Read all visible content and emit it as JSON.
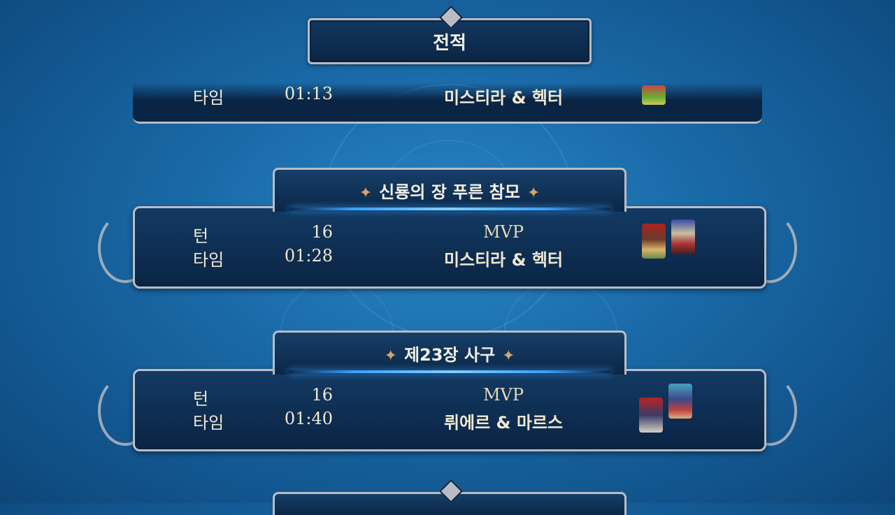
{
  "header": {
    "title": "전적"
  },
  "labels": {
    "turn": "턴",
    "time": "타임",
    "mvp": "MVP"
  },
  "partial_record": {
    "time": "01:13",
    "mvp_name": "미스티라 & 헥터"
  },
  "records": [
    {
      "stage": "신룡의 장  푸른 참모",
      "turns": "16",
      "time": "01:28",
      "mvp_name": "미스티라 & 헥터"
    },
    {
      "stage": "제23장  사구",
      "turns": "16",
      "time": "01:40",
      "mvp_name": "뤼에르 & 마르스"
    }
  ],
  "colors": {
    "accent_glow": "#3aa0ff",
    "frame": "#b9bcc4",
    "ornament": "#d6a36c"
  },
  "icons": {
    "stage_ornament": "four-point-star"
  }
}
